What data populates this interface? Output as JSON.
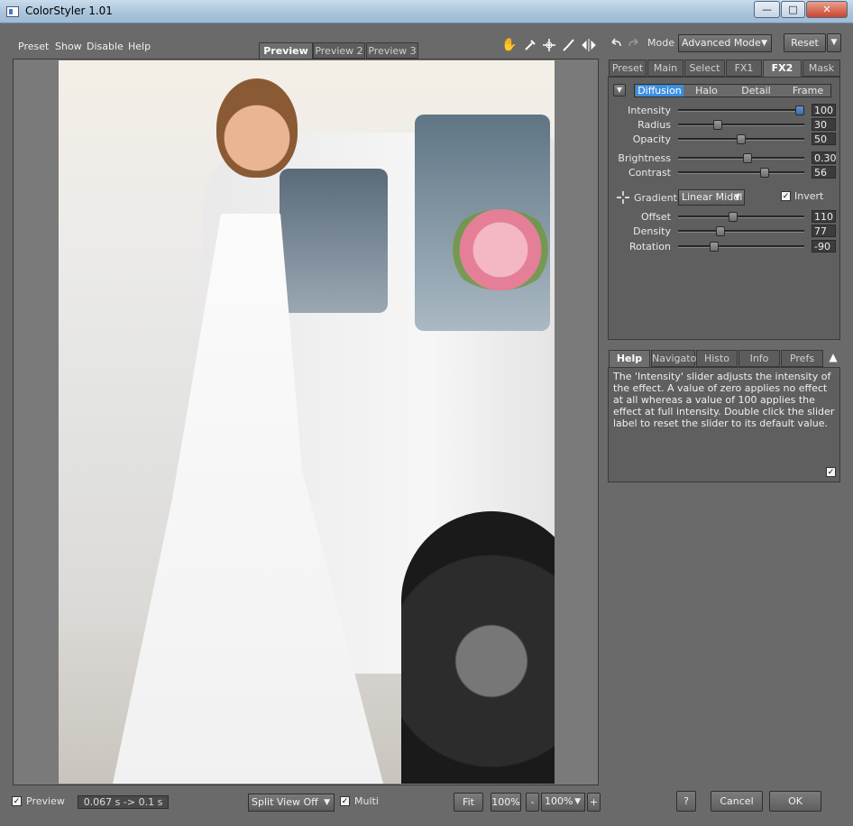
{
  "window": {
    "title": "ColorStyler 1.01",
    "minimize": "—",
    "maximize": "□",
    "close": "✕"
  },
  "menu": [
    "Preset",
    "Show",
    "Disable",
    "Help"
  ],
  "preview_tabs": [
    "Preview 1",
    "Preview 2",
    "Preview 3"
  ],
  "toolbar": {
    "mode_label": "Mode",
    "mode_value": "Advanced Mode",
    "reset_label": "Reset",
    "tools": [
      "hand-icon",
      "eyedropper-icon",
      "crosshair-icon",
      "brush-icon",
      "split-compare-icon"
    ]
  },
  "right_tabs": [
    "Preset",
    "Main",
    "Select",
    "FX1",
    "FX2",
    "Mask"
  ],
  "sub_tabs": [
    "Diffusion",
    "Halo",
    "Detail",
    "Frame"
  ],
  "sliders": [
    {
      "label": "Intensity",
      "value": "100",
      "pos": 1.0
    },
    {
      "label": "Radius",
      "value": "30",
      "pos": 0.3
    },
    {
      "label": "Opacity",
      "value": "50",
      "pos": 0.5
    },
    {
      "label": "Brightness",
      "value": "0.30",
      "pos": 0.55
    },
    {
      "label": "Contrast",
      "value": "56",
      "pos": 0.7
    }
  ],
  "gradient": {
    "label": "Gradient",
    "value": "Linear Middl",
    "invert_label": "Invert",
    "invert_checked": true
  },
  "gradient_sliders": [
    {
      "label": "Offset",
      "value": "110",
      "pos": 0.43
    },
    {
      "label": "Density",
      "value": "77",
      "pos": 0.32
    },
    {
      "label": "Rotation",
      "value": "-90",
      "pos": 0.27
    }
  ],
  "help_tabs": [
    "Help",
    "Navigator",
    "Histo",
    "Info",
    "Prefs"
  ],
  "help_text": "The 'Intensity' slider adjusts the intensity of the effect. A value of zero applies no effect at all whereas a value of 100 applies the effect at full intensity. Double click the slider label to reset the slider to its default value.",
  "bottom": {
    "preview_label": "Preview",
    "timing": "0.067 s -> 0.1 s",
    "split_view": "Split View Off",
    "multi_label": "Multi",
    "fit_label": "Fit",
    "zoom_fixed": "100%",
    "zoom_minus": "-",
    "zoom_value": "100%",
    "zoom_plus": "+",
    "help_btn": "?",
    "cancel_label": "Cancel",
    "ok_label": "OK"
  }
}
